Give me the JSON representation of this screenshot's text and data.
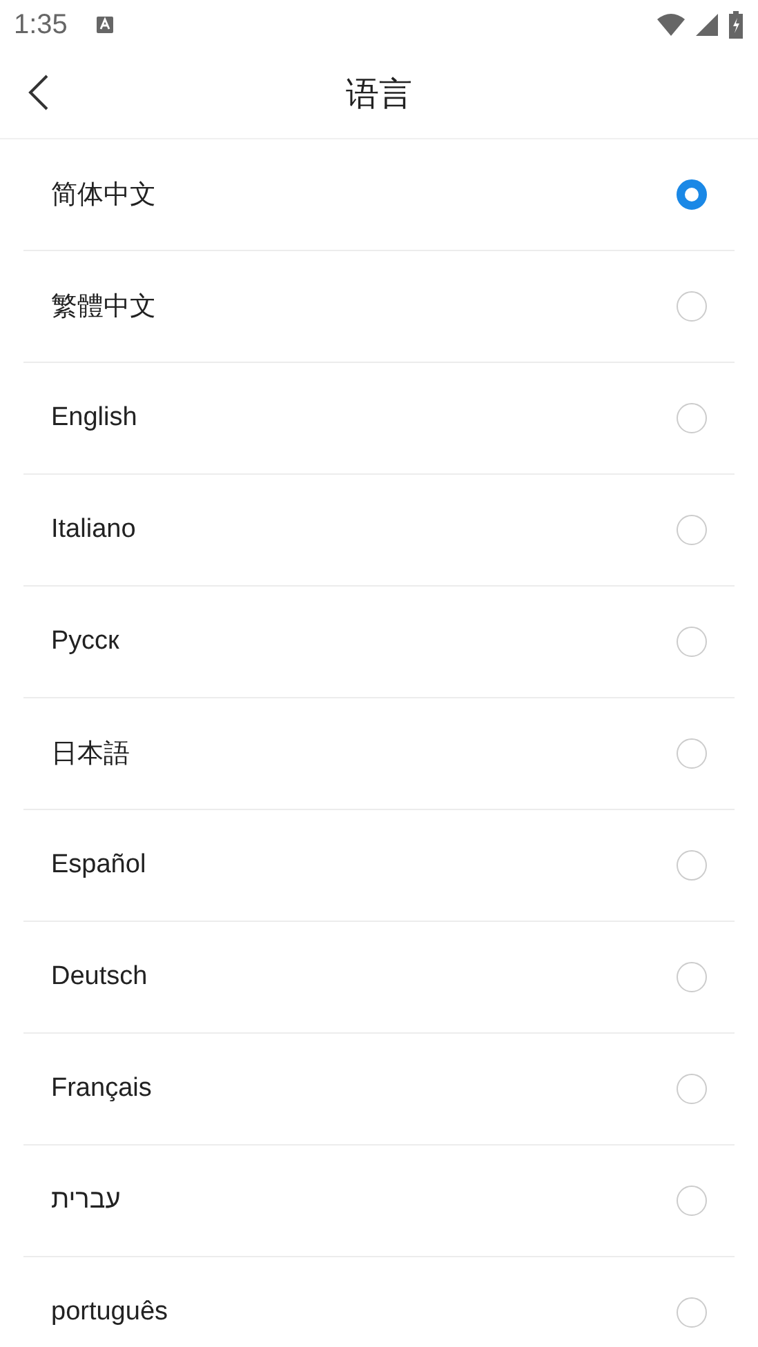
{
  "status_bar": {
    "time": "1:35"
  },
  "header": {
    "title": "语言"
  },
  "languages": [
    {
      "label": "简体中文",
      "selected": true
    },
    {
      "label": "繁體中文",
      "selected": false
    },
    {
      "label": "English",
      "selected": false
    },
    {
      "label": "Italiano",
      "selected": false
    },
    {
      "label": "Русск",
      "selected": false
    },
    {
      "label": "日本語",
      "selected": false
    },
    {
      "label": "Español",
      "selected": false
    },
    {
      "label": "Deutsch",
      "selected": false
    },
    {
      "label": "Français",
      "selected": false
    },
    {
      "label": "עברית",
      "selected": false
    },
    {
      "label": "português",
      "selected": false
    }
  ]
}
